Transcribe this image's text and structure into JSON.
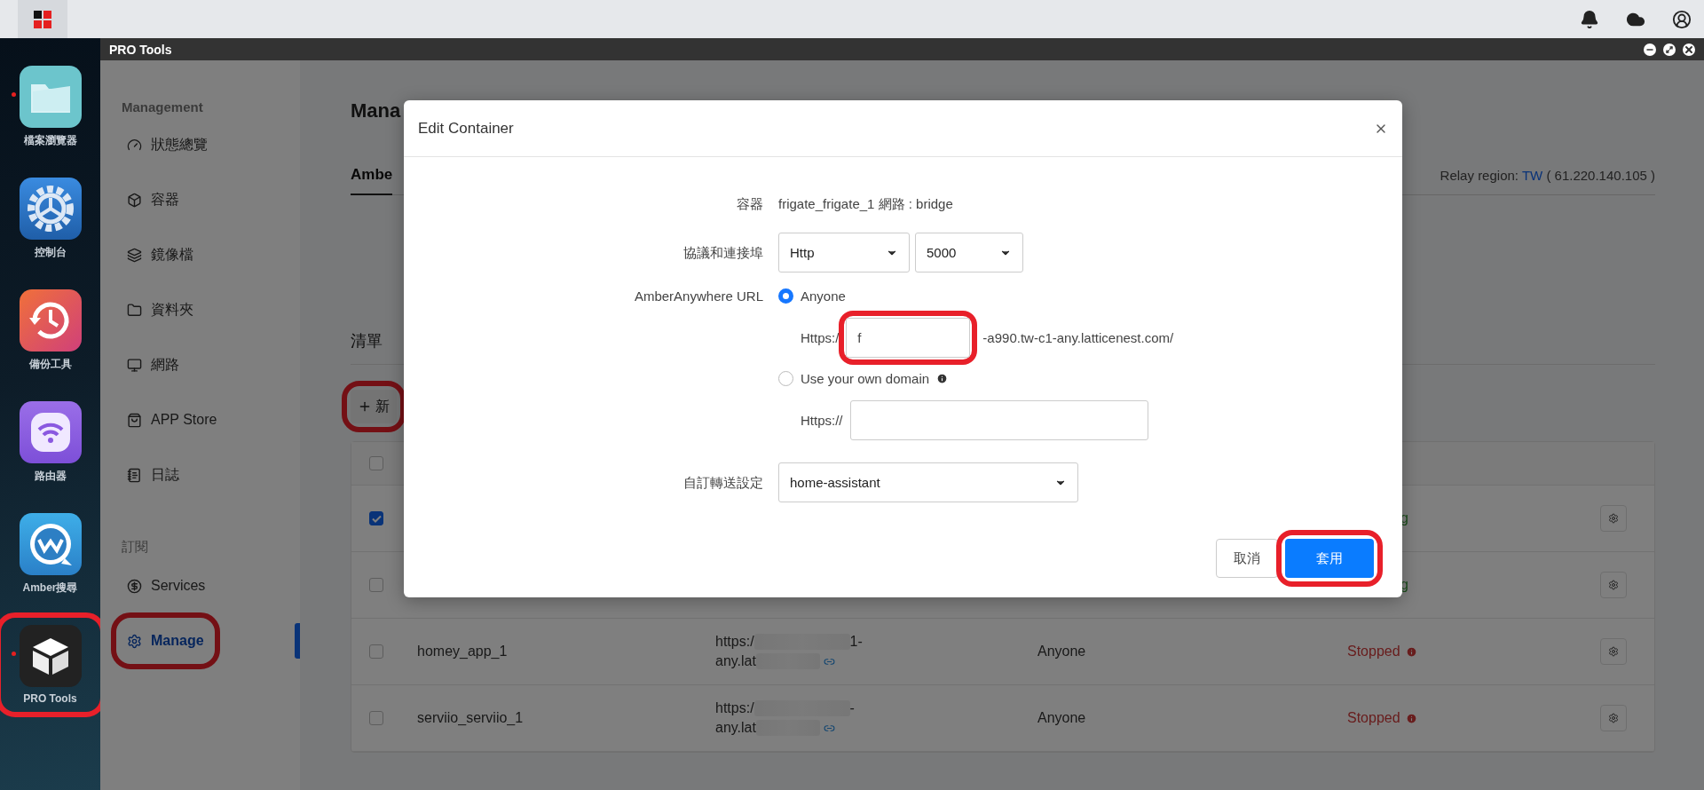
{
  "dock": [
    {
      "label": "檔案瀏覽器",
      "kind": "files",
      "running": true,
      "highlighted": false
    },
    {
      "label": "控制台",
      "kind": "control",
      "running": false,
      "highlighted": false
    },
    {
      "label": "備份工具",
      "kind": "backup",
      "running": false,
      "highlighted": false
    },
    {
      "label": "路由器",
      "kind": "router",
      "running": false,
      "highlighted": false
    },
    {
      "label": "Amber搜尋",
      "kind": "search",
      "running": false,
      "highlighted": false
    },
    {
      "label": "PRO Tools",
      "kind": "pro",
      "running": true,
      "highlighted": true
    }
  ],
  "window": {
    "title": "PRO Tools"
  },
  "sidebar": {
    "groups": [
      {
        "heading": "Management",
        "items": [
          {
            "label": "狀態總覽",
            "selected": false,
            "highlighted": false
          },
          {
            "label": "容器",
            "selected": false,
            "highlighted": false
          },
          {
            "label": "鏡像檔",
            "selected": false,
            "highlighted": false
          },
          {
            "label": "資料夾",
            "selected": false,
            "highlighted": false
          },
          {
            "label": "網路",
            "selected": false,
            "highlighted": false
          },
          {
            "label": "APP Store",
            "selected": false,
            "highlighted": false
          },
          {
            "label": "日誌",
            "selected": false,
            "highlighted": false
          }
        ]
      },
      {
        "heading": "訂閱",
        "items": [
          {
            "label": "Services",
            "selected": false,
            "highlighted": false
          },
          {
            "label": "Manage",
            "selected": true,
            "highlighted": true
          }
        ]
      }
    ]
  },
  "main": {
    "title": "Mana",
    "tabs": [
      {
        "label": "Ambe",
        "selected": true
      }
    ],
    "relay": {
      "label": "Relay region:",
      "region": "TW",
      "ip": "( 61.220.140.105 )"
    },
    "list_title": "清單",
    "add_button": {
      "label": "新",
      "highlighted": true
    },
    "select_all_checked": false,
    "rows": [
      {
        "checked": true,
        "status": "g",
        "kind": "running"
      },
      {
        "checked": false,
        "status": "g",
        "kind": "running"
      },
      {
        "checked": false,
        "name": "homey_app_1",
        "url_line_1": "https:/",
        "url_line_1_end": "1-",
        "url_line_2": "any.lat",
        "access": "Anyone",
        "status": "Stopped",
        "kind": "stopped"
      },
      {
        "checked": false,
        "name": "serviio_serviio_1",
        "url_line_1": "https:/",
        "url_line_1_end": "-",
        "url_line_2": "any.lat",
        "access": "Anyone",
        "status": "Stopped",
        "kind": "stopped"
      }
    ]
  },
  "dialog": {
    "title": "Edit Container",
    "container_label": "容器",
    "container_value": "frigate_frigate_1 網路 : bridge",
    "protocol_label": "協議和連接埠",
    "protocol": "Http",
    "port": "5000",
    "url_label": "AmberAnywhere URL",
    "options": [
      {
        "label": "Anyone",
        "selected": true,
        "info": false,
        "prefix": "Https:/",
        "value": "f",
        "suffix": "-a990.tw-c1-any.latticenest.com/",
        "highlighted": true
      },
      {
        "label": "Use your own domain",
        "selected": false,
        "info": true,
        "prefix": "Https://",
        "highlighted": false
      }
    ],
    "forward_label": "自訂轉送設定",
    "forward": "home-assistant",
    "buttons": [
      {
        "label": "取消",
        "kind": "secondary",
        "highlighted": false
      },
      {
        "label": "套用",
        "kind": "primary",
        "highlighted": true
      }
    ]
  }
}
